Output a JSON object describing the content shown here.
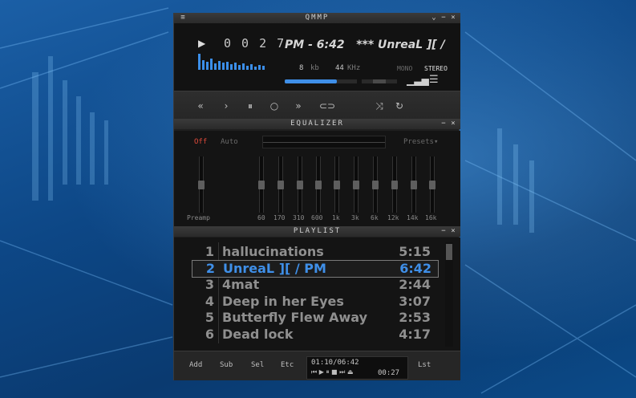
{
  "main": {
    "title": "QMMP",
    "time_digits": "0 0 2 7",
    "marquee": "PM - 6:42   *** UnreaL ][ /",
    "bitrate": "8",
    "bitrate_unit": "kb",
    "samplerate": "44",
    "samplerate_unit": "KHz",
    "mono": "MONO",
    "stereo": "STEREO",
    "volume_level": 0.72,
    "controls": [
      "«",
      "›",
      "⏸",
      "○",
      "»",
      "⊂⊃",
      "⤨",
      "↻"
    ]
  },
  "equalizer": {
    "title": "EQUALIZER",
    "off": "Off",
    "auto": "Auto",
    "presets": "Presets",
    "preamp": "Preamp",
    "bands": [
      "60",
      "170",
      "310",
      "600",
      "1k",
      "3k",
      "6k",
      "12k",
      "14k",
      "16k"
    ]
  },
  "playlist": {
    "title": "PLAYLIST",
    "items": [
      {
        "num": "1",
        "title": "hallucinations",
        "duration": "5:15"
      },
      {
        "num": "2",
        "title": "UnreaL ][ / PM",
        "duration": "6:42"
      },
      {
        "num": "3",
        "title": "4mat",
        "duration": "2:44"
      },
      {
        "num": "4",
        "title": "Deep in her Eyes",
        "duration": "3:07"
      },
      {
        "num": "5",
        "title": "Butterfly Flew Away",
        "duration": "2:53"
      },
      {
        "num": "6",
        "title": "Dead lock",
        "duration": "4:17"
      }
    ],
    "footer": {
      "add": "Add",
      "sub": "Sub",
      "sel": "Sel",
      "etc": "Etc",
      "lst": "Lst",
      "total_time": "01:10/06:42",
      "mini_time": "00:27",
      "mini_controls": "⏮ ▶ ⏸ ■ ⏭ ⏏"
    }
  },
  "colors": {
    "accent_blue": "#3f8fe8",
    "off_red": "#e04a3a",
    "panel": "#141414"
  }
}
